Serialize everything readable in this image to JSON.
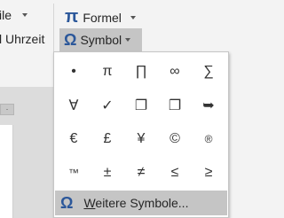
{
  "ribbon": {
    "left_partial_1": "ile",
    "left_partial_2": "l Uhrzeit",
    "formel": {
      "icon": "π",
      "label": "Formel"
    },
    "symbol": {
      "icon": "Ω",
      "label": "Symbol"
    }
  },
  "document": {
    "tab_label": "·"
  },
  "symbol_panel": {
    "symbols": [
      "•",
      "π",
      "∏",
      "∞",
      "∑",
      "∀",
      "✓",
      "❐",
      "❐",
      "➥",
      "€",
      "£",
      "¥",
      "©",
      "®",
      "™",
      "±",
      "≠",
      "≤",
      "≥"
    ],
    "more": {
      "icon": "Ω",
      "accel": "W",
      "label_rest": "eitere Symbole..."
    }
  },
  "colors": {
    "accent": "#2b579a",
    "hover": "#c5c5c5"
  }
}
